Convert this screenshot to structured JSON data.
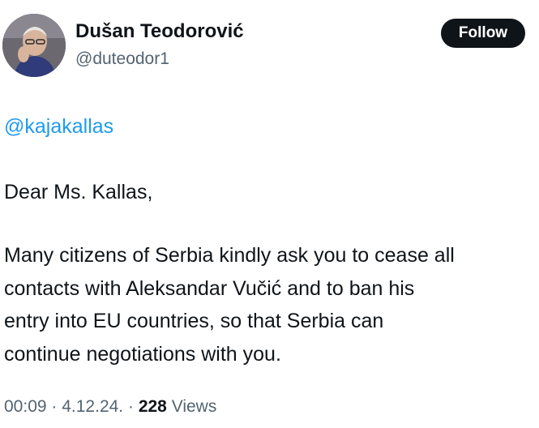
{
  "author": {
    "display_name": "Dušan Teodorović",
    "handle": "@duteodor1"
  },
  "follow_button": {
    "label": "Follow"
  },
  "tweet": {
    "mention": "@kajakallas",
    "greeting": "Dear Ms. Kallas,",
    "body_lines": [
      "Many citizens of Serbia kindly ask you to cease all",
      "contacts with Aleksandar Vučić and to ban his",
      "entry into EU countries, so that Serbia can",
      "continue negotiations with you."
    ]
  },
  "meta": {
    "time": "00:09",
    "separator_1": " · ",
    "date": "4.12.24.",
    "separator_2": " · ",
    "views_count": "228",
    "views_label": " Views"
  },
  "colors": {
    "link": "#1d9bf0",
    "secondary_text": "#536471",
    "primary_text": "#0f1419",
    "button_bg": "#0f1419"
  }
}
